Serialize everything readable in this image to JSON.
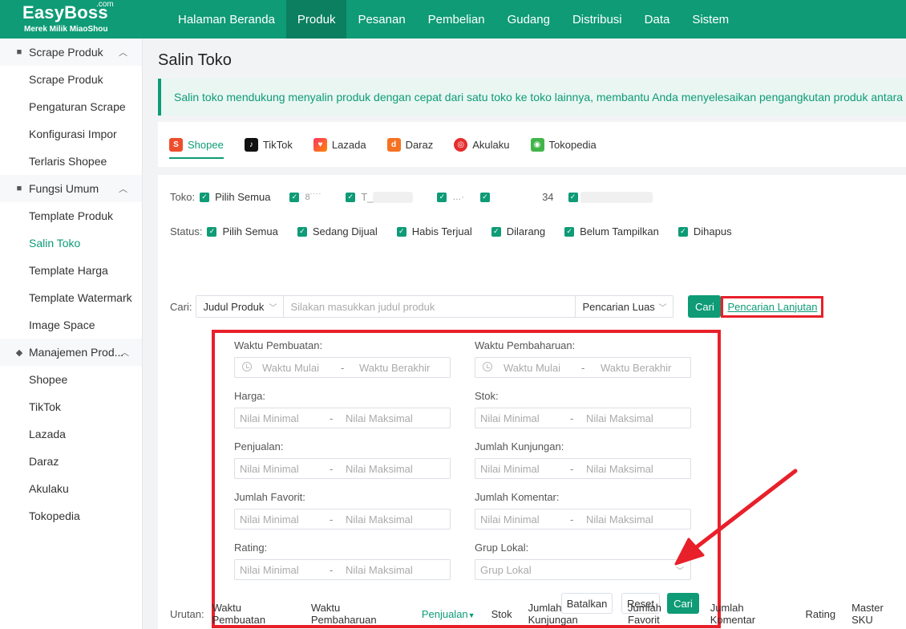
{
  "logo": {
    "brand": "EasyBoss",
    "dotcom": ".com",
    "tagline": "Merek Milik MiaoShou"
  },
  "nav": [
    "Halaman Beranda",
    "Produk",
    "Pesanan",
    "Pembelian",
    "Gudang",
    "Distribusi",
    "Data",
    "Sistem"
  ],
  "nav_active": "Produk",
  "sidebar": {
    "group1": "Scrape Produk",
    "group1_items": [
      "Scrape Produk",
      "Pengaturan Scrape",
      "Konfigurasi Impor",
      "Terlaris Shopee"
    ],
    "group2": "Fungsi Umum",
    "group2_items": [
      "Template Produk",
      "Salin Toko",
      "Template Harga",
      "Template Watermark",
      "Image Space"
    ],
    "group3": "Manajemen Prod...",
    "group3_items": [
      "Shopee",
      "TikTok",
      "Lazada",
      "Daraz",
      "Akulaku",
      "Tokopedia"
    ]
  },
  "page_title": "Salin Toko",
  "notice": "Salin toko mendukung menyalin produk dengan cepat dari satu toko ke toko lainnya, membantu Anda menyelesaikan pengangkutan produk antara berbagai toko",
  "platforms": [
    "Shopee",
    "TikTok",
    "Lazada",
    "Daraz",
    "Akulaku",
    "Tokopedia"
  ],
  "colors": {
    "accent": "#0e9b76",
    "highlight": "#e8202a"
  },
  "toko": {
    "label": "Toko:",
    "select_all": "Pilih Semua",
    "shops": [
      "8˙˙˙˙",
      "T_",
      "…·",
      "",
      "34",
      ""
    ]
  },
  "status": {
    "label": "Status:",
    "options": [
      "Pilih Semua",
      "Sedang Dijual",
      "Habis Terjual",
      "Dilarang",
      "Belum Tampilkan",
      "Dihapus"
    ]
  },
  "search": {
    "label": "Cari:",
    "field": "Judul Produk",
    "placeholder": "Silakan masukkan judul produk",
    "mode": "Pencarian Luas",
    "button": "Cari",
    "advanced": "Pencarian Lanjutan"
  },
  "advanced": {
    "created": "Waktu Pembuatan:",
    "updated": "Waktu Pembaharuan:",
    "start": "Waktu Mulai",
    "end": "Waktu Berakhir",
    "price": "Harga:",
    "stock": "Stok:",
    "sales": "Penjualan:",
    "visits": "Jumlah Kunjungan:",
    "favorites": "Jumlah Favorit:",
    "comments": "Jumlah Komentar:",
    "rating": "Rating:",
    "local_group": "Grup Lokal:",
    "local_group_placeholder": "Grup Lokal",
    "min": "Nilai Minimal",
    "max": "Nilai Maksimal",
    "dash": "-",
    "cancel": "Batalkan",
    "reset": "Reset",
    "search": "Cari"
  },
  "sort": {
    "label": "Urutan:",
    "items": [
      "Waktu Pembuatan",
      "Waktu Pembaharuan",
      "Penjualan",
      "Stok",
      "Jumlah Kunjungan",
      "Jumlah Favorit",
      "Jumlah Komentar",
      "Rating",
      "Master SKU"
    ],
    "active": "Penjualan"
  }
}
